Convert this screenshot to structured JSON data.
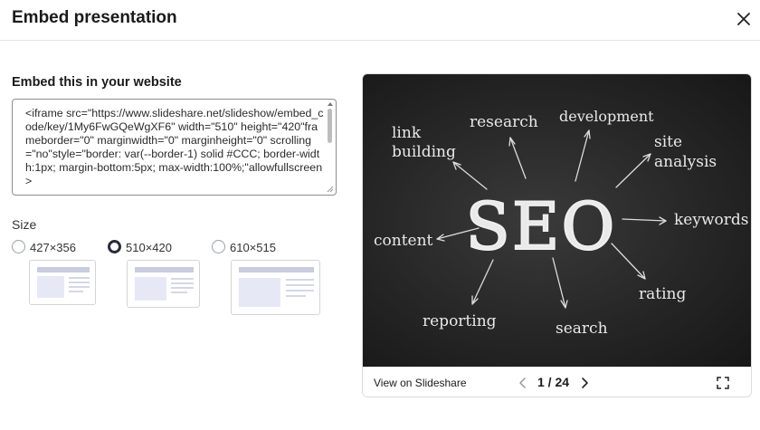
{
  "dialog": {
    "title": "Embed presentation"
  },
  "embed": {
    "label": "Embed this in your website",
    "code": "<iframe src=\"https://www.slideshare.net/slideshow/embed_code/key/1My6FwGQeWgXF6\" width=\"510\" height=\"420\"frameborder=\"0\" marginwidth=\"0\" marginheight=\"0\" scrolling=\"no\"style=\"border: var(--border-1) solid #CCC; border-width:1px; margin-bottom:5px; max-width:100%;\"allowfullscreen>"
  },
  "size": {
    "label": "Size",
    "options": [
      {
        "label": "427×356",
        "selected": false
      },
      {
        "label": "510×420",
        "selected": true
      },
      {
        "label": "610×515",
        "selected": false
      }
    ]
  },
  "slide": {
    "center_word": "SEO",
    "keywords": [
      "link",
      "building",
      "research",
      "development",
      "site",
      "analysis",
      "keywords",
      "rating",
      "search",
      "reporting",
      "content"
    ]
  },
  "viewer": {
    "view_link": "View on Slideshare",
    "page_counter": "1 / 24"
  },
  "icons": {
    "close": "close-icon",
    "prev": "chevron-left-icon",
    "next": "chevron-right-icon",
    "fullscreen": "fullscreen-icon"
  }
}
